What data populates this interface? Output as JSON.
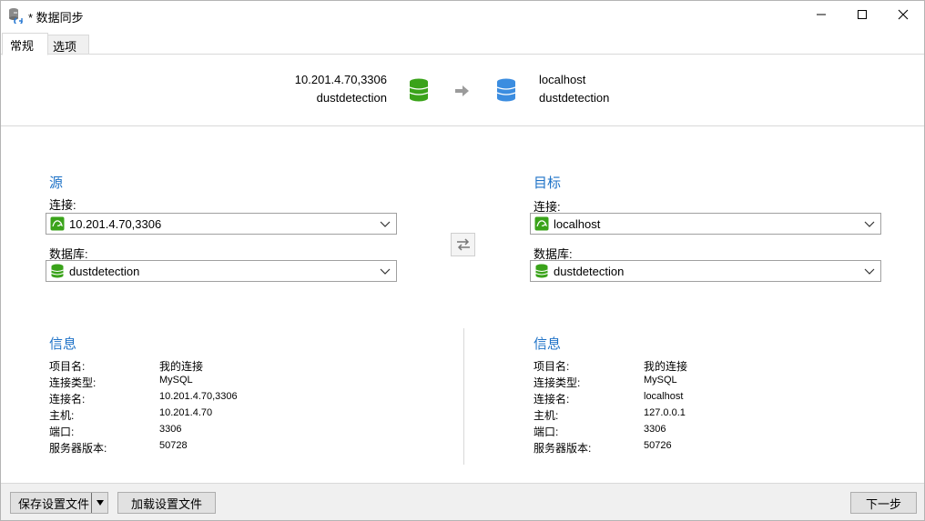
{
  "window": {
    "title": "* 数据同步",
    "icon": "sync-database-icon"
  },
  "tabs": [
    {
      "label": "常规",
      "active": true
    },
    {
      "label": "选项",
      "active": false
    }
  ],
  "summary": {
    "source_host": "10.201.4.70,3306",
    "source_db": "dustdetection",
    "target_host": "localhost",
    "target_db": "dustdetection",
    "source_color": "#3aa31a",
    "target_color": "#3b8de0"
  },
  "source": {
    "title": "源",
    "connection_label": "连接:",
    "connection_value": "10.201.4.70,3306",
    "database_label": "数据库:",
    "database_value": "dustdetection"
  },
  "target": {
    "title": "目标",
    "connection_label": "连接:",
    "connection_value": "localhost",
    "database_label": "数据库:",
    "database_value": "dustdetection"
  },
  "source_info": {
    "title": "信息",
    "rows": [
      {
        "key": "项目名:",
        "value": "我的连接"
      },
      {
        "key": "连接类型:",
        "value": "MySQL"
      },
      {
        "key": "连接名:",
        "value": "10.201.4.70,3306"
      },
      {
        "key": "主机:",
        "value": "10.201.4.70"
      },
      {
        "key": "端口:",
        "value": "3306"
      },
      {
        "key": "服务器版本:",
        "value": "50728"
      }
    ]
  },
  "target_info": {
    "title": "信息",
    "rows": [
      {
        "key": "项目名:",
        "value": "我的连接"
      },
      {
        "key": "连接类型:",
        "value": "MySQL"
      },
      {
        "key": "连接名:",
        "value": "localhost"
      },
      {
        "key": "主机:",
        "value": "127.0.0.1"
      },
      {
        "key": "端口:",
        "value": "3306"
      },
      {
        "key": "服务器版本:",
        "value": "50726"
      }
    ]
  },
  "footer": {
    "save_profile": "保存设置文件",
    "load_profile": "加载设置文件",
    "next": "下一步"
  },
  "colors": {
    "accent": "#1e72c7",
    "mysql_green": "#3aa31a"
  }
}
